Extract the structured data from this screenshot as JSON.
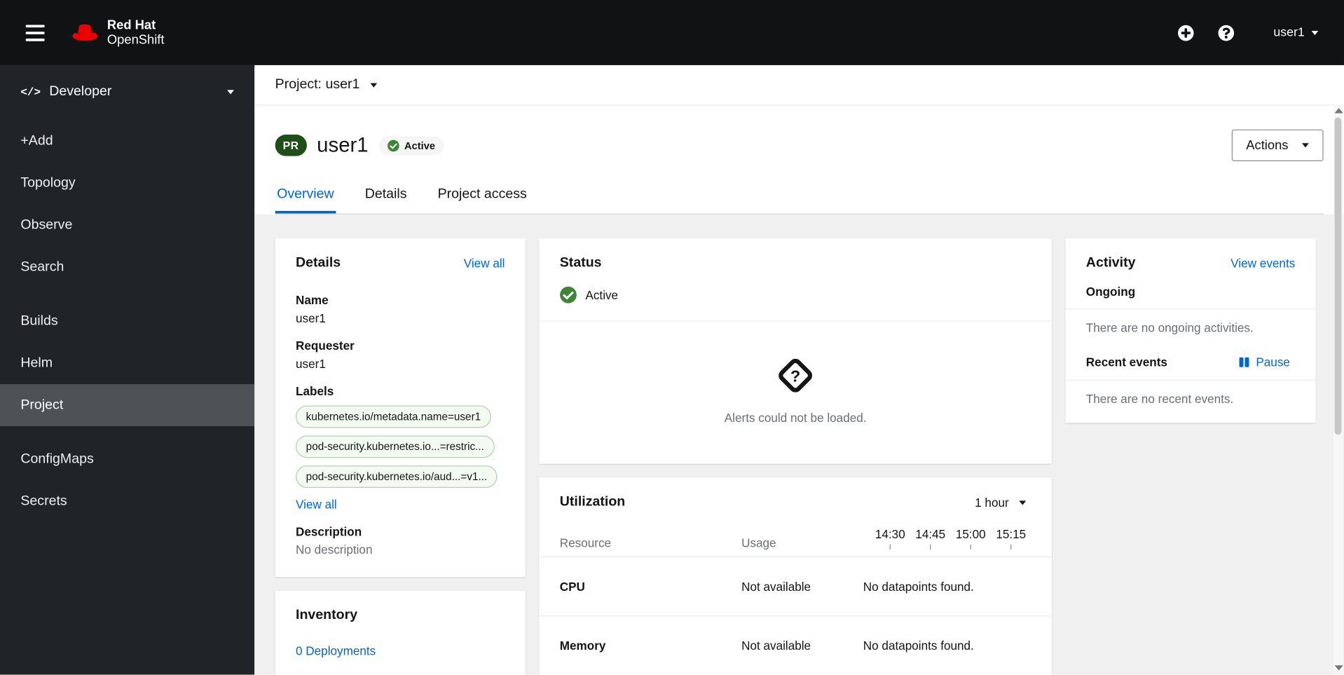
{
  "colors": {
    "brand_red": "#ee0000",
    "masthead_bg": "#111214",
    "sidebar_bg": "#212427",
    "link_blue": "#0066cc",
    "success_green": "#3e8635",
    "project_badge_bg": "#1e4f18",
    "dashboard_bg": "#f0f0f0"
  },
  "masthead": {
    "brand_line1": "Red Hat",
    "brand_line2": "OpenShift",
    "user": "user1"
  },
  "sidebar": {
    "perspective": "Developer",
    "developer_icon": "</>",
    "items": [
      {
        "label": "+Add"
      },
      {
        "label": "Topology"
      },
      {
        "label": "Observe"
      },
      {
        "label": "Search"
      },
      {
        "label": "Builds"
      },
      {
        "label": "Helm"
      },
      {
        "label": "Project",
        "selected": true
      },
      {
        "label": "ConfigMaps"
      },
      {
        "label": "Secrets"
      }
    ]
  },
  "context_bar": {
    "project_label": "Project: user1"
  },
  "page_header": {
    "badge": "PR",
    "title": "user1",
    "status": "Active",
    "actions_label": "Actions"
  },
  "tabs": [
    {
      "label": "Overview",
      "active": true
    },
    {
      "label": "Details",
      "active": false
    },
    {
      "label": "Project access",
      "active": false
    }
  ],
  "details_card": {
    "title": "Details",
    "view_all": "View all",
    "fields": [
      {
        "label": "Name",
        "value": "user1"
      },
      {
        "label": "Requester",
        "value": "user1"
      }
    ],
    "labels_label": "Labels",
    "labels": [
      "kubernetes.io/metadata.name=user1",
      "pod-security.kubernetes.io...=restric...",
      "pod-security.kubernetes.io/aud...=v1..."
    ],
    "labels_view_all": "View all",
    "description_label": "Description",
    "description_value": "No description"
  },
  "inventory_card": {
    "title": "Inventory",
    "items": [
      "0 Deployments"
    ]
  },
  "status_card": {
    "title": "Status",
    "status": "Active",
    "alerts_message": "Alerts could not be loaded."
  },
  "utilization_card": {
    "title": "Utilization",
    "duration": "1 hour",
    "columns": [
      "Resource",
      "Usage"
    ],
    "times": [
      "14:30",
      "14:45",
      "15:00",
      "15:15"
    ],
    "rows": [
      {
        "resource": "CPU",
        "usage": "Not available",
        "data": "No datapoints found."
      },
      {
        "resource": "Memory",
        "usage": "Not available",
        "data": "No datapoints found."
      }
    ]
  },
  "activity_card": {
    "title": "Activity",
    "view_events": "View events",
    "ongoing_label": "Ongoing",
    "ongoing_empty": "There are no ongoing activities.",
    "recent_label": "Recent events",
    "pause_label": "Pause",
    "recent_empty": "There are no recent events."
  }
}
